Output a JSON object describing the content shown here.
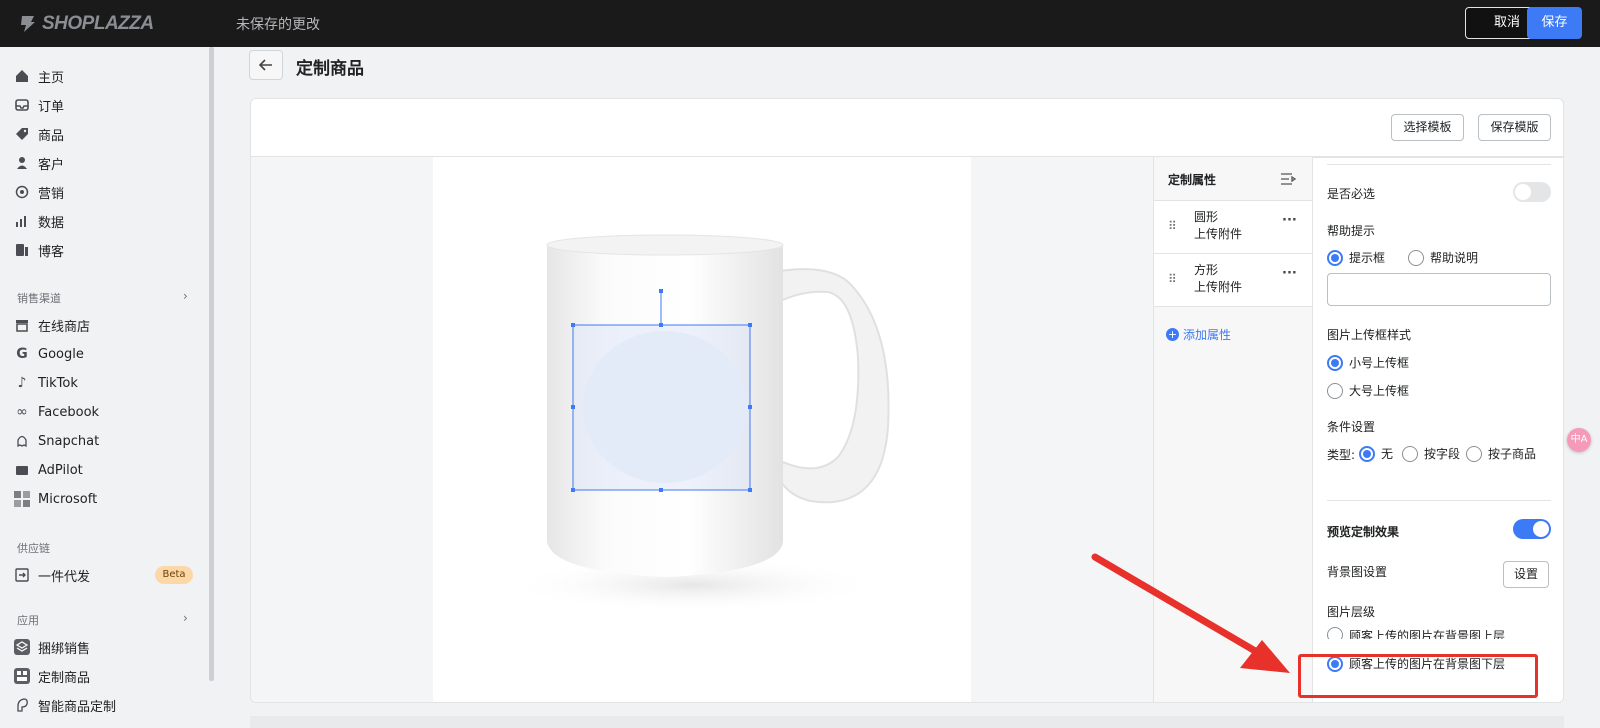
{
  "topbar": {
    "logo": "SHOPLAZZA",
    "unsaved": "未保存的更改",
    "cancel": "取消",
    "save": "保存"
  },
  "sidebar": {
    "main": [
      "主页",
      "订单",
      "商品",
      "客户",
      "营销",
      "数据",
      "博客"
    ],
    "sales_title": "销售渠道",
    "sales": [
      "在线商店",
      "Google",
      "TikTok",
      "Facebook",
      "Snapchat",
      "AdPilot",
      "Microsoft"
    ],
    "supply_title": "供应链",
    "supply": [
      "一件代发"
    ],
    "beta": "Beta",
    "apps_title": "应用",
    "apps": [
      "捆绑销售",
      "定制商品",
      "智能商品定制"
    ]
  },
  "page": {
    "title": "定制商品"
  },
  "header": {
    "select_template": "选择模板",
    "save_template": "保存模版"
  },
  "attributes": {
    "title": "定制属性",
    "items": [
      {
        "line1": "圆形",
        "line2": "上传附件"
      },
      {
        "line1": "方形",
        "line2": "上传附件"
      }
    ],
    "add": "添加属性"
  },
  "props": {
    "required": "是否必选",
    "help_tip": "帮助提示",
    "help_opts": [
      "提示框",
      "帮助说明"
    ],
    "upload_style": "图片上传框样式",
    "upload_opts": [
      "小号上传框",
      "大号上传框"
    ],
    "condition": "条件设置",
    "type_label": "类型:",
    "type_opts": [
      "无",
      "按字段",
      "按子商品"
    ],
    "preview": "预览定制效果",
    "bg_setting": "背景图设置",
    "set_btn": "设置",
    "layer": "图片层级",
    "layer_opts": [
      "顾客上传的图片在背景图上层",
      "顾客上传的图片在背景图下层"
    ]
  },
  "colors": {
    "accent": "#3d7af5",
    "highlight": "#e8312a",
    "topbar": "#1a1a1a"
  }
}
